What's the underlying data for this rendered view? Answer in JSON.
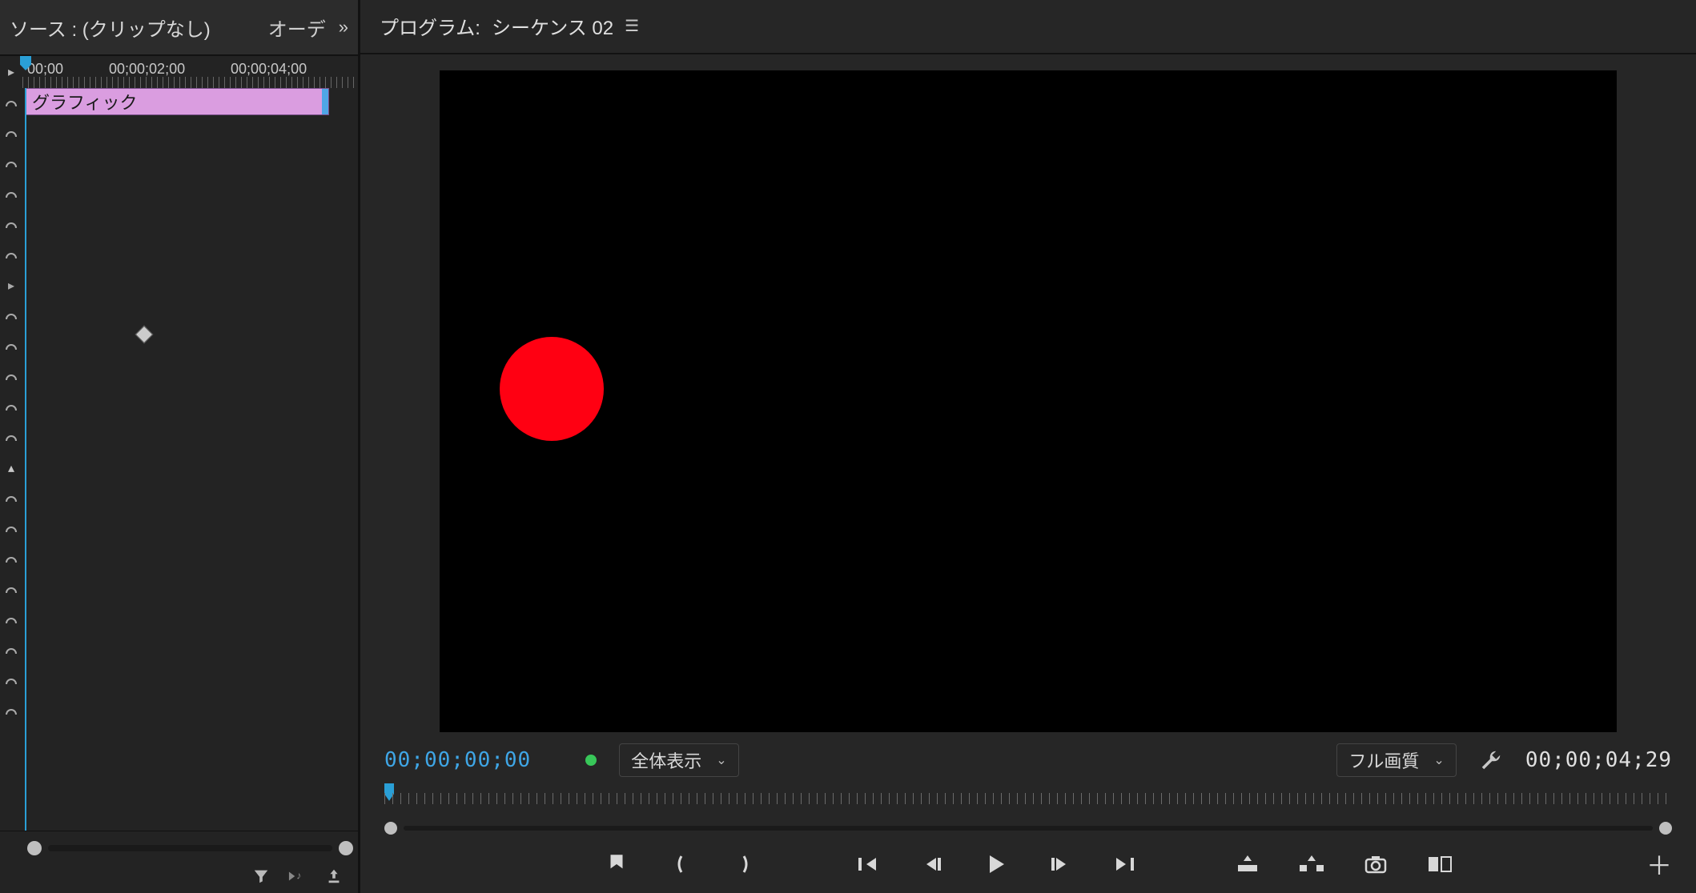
{
  "source_panel": {
    "title": "ソース : (クリップなし)",
    "audio_label": "オーデ",
    "ruler_labels": [
      "00;00",
      "00;00;02;00",
      "00;00;04;00"
    ],
    "clip_label": "グラフィック"
  },
  "program_panel": {
    "title_prefix": "プログラム:",
    "sequence_name": "シーケンス 02",
    "timecode_current": "00;00;00;00",
    "display_mode": "全体表示",
    "quality": "フル画質",
    "timecode_total": "00;00;04;29"
  },
  "colors": {
    "circle": "#ff0012",
    "accent": "#2a9fd6",
    "clip_bg": "#da9de0"
  }
}
